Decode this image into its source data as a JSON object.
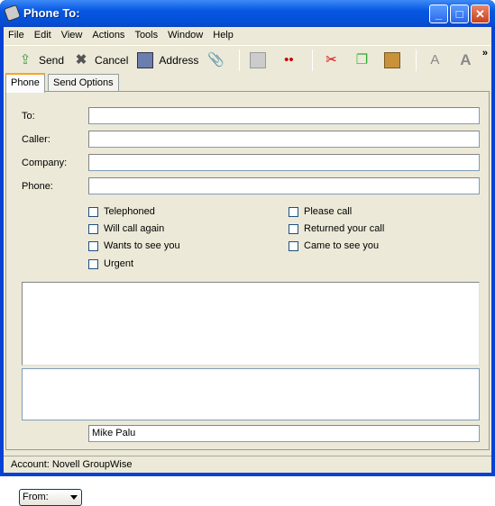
{
  "window": {
    "title": "Phone To:",
    "minimize": "_",
    "maximize": "□",
    "close": "✕"
  },
  "menu": [
    "File",
    "Edit",
    "View",
    "Actions",
    "Tools",
    "Window",
    "Help"
  ],
  "toolbar": {
    "send": "Send",
    "cancel": "Cancel",
    "address": "Address",
    "overflow": "»",
    "icons": [
      "send-icon",
      "cancel-icon",
      "address-book-icon",
      "attach-icon",
      "save-icon",
      "spell-check-icon",
      "cut-icon",
      "copy-icon",
      "paste-icon",
      "font-icon",
      "bold-icon",
      "italic-icon"
    ]
  },
  "tabs": [
    "Phone",
    "Send Options"
  ],
  "fields": {
    "to": {
      "label": "To:",
      "value": ""
    },
    "caller": {
      "label": "Caller:",
      "value": ""
    },
    "company": {
      "label": "Company:",
      "value": ""
    },
    "phone": {
      "label": "Phone:",
      "value": ""
    }
  },
  "checkboxes_left": [
    {
      "label": "Telephoned",
      "checked": false
    },
    {
      "label": "Will call again",
      "checked": false
    },
    {
      "label": "Wants to see you",
      "checked": false
    },
    {
      "label": "Urgent",
      "checked": false
    }
  ],
  "checkboxes_right": [
    {
      "label": "Please call",
      "checked": false
    },
    {
      "label": "Returned your call",
      "checked": false
    },
    {
      "label": "Came to see you",
      "checked": false
    }
  ],
  "from": {
    "label": "From:",
    "value": "Mike Palu"
  },
  "status": "Account: Novell GroupWise"
}
